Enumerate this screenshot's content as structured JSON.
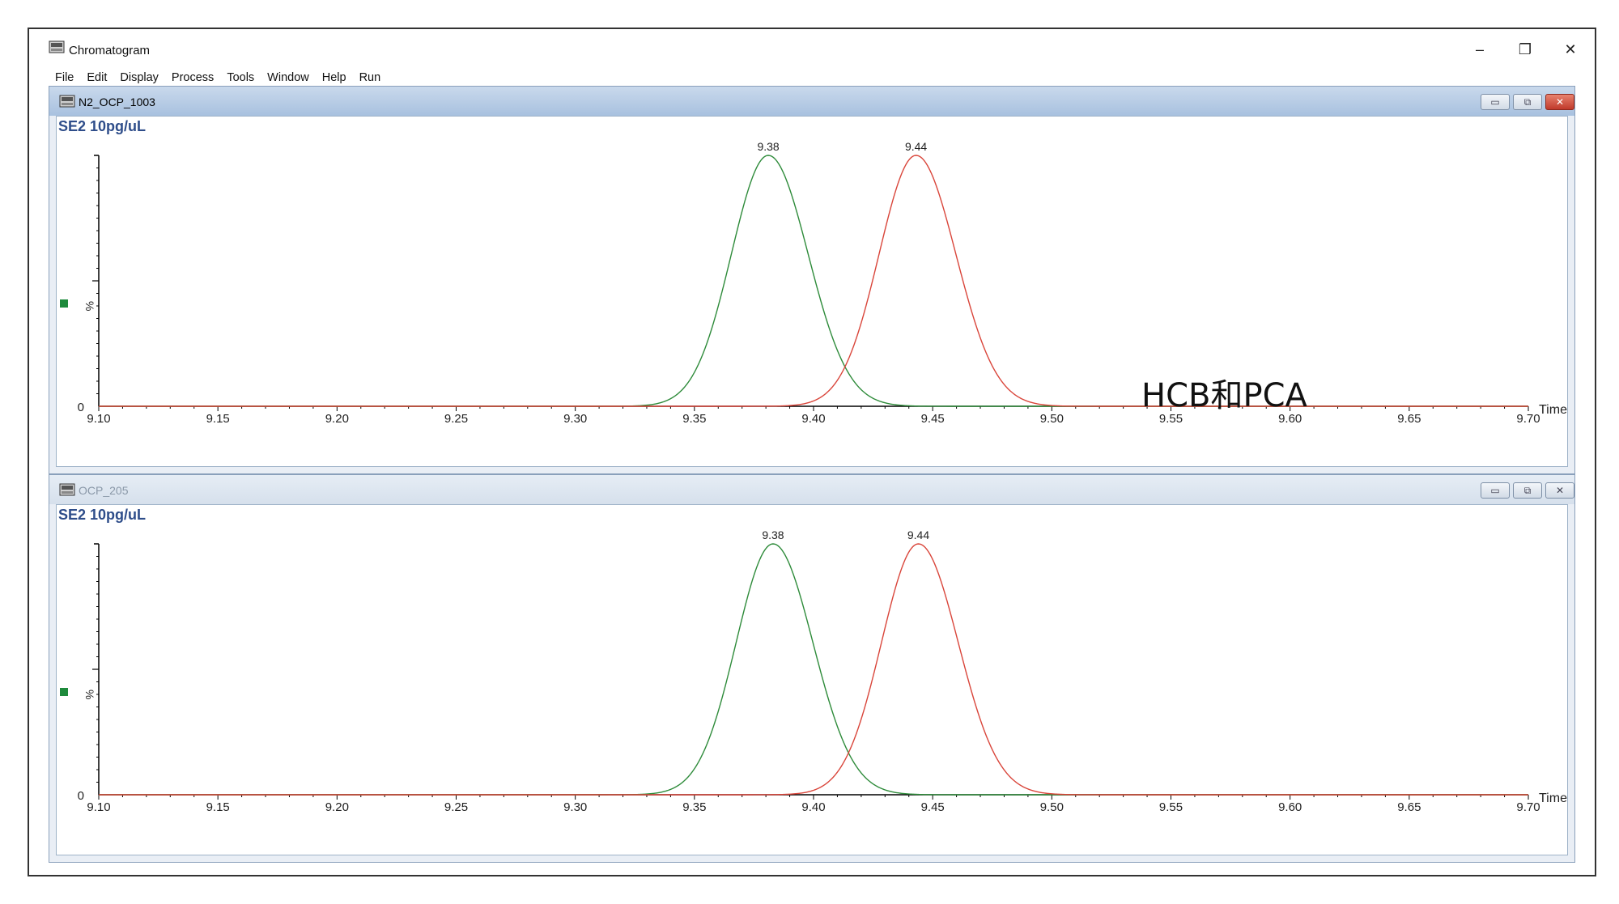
{
  "window": {
    "title": "Chromatogram",
    "controls": {
      "minimize": "–",
      "restore": "❐",
      "close": "✕"
    }
  },
  "menu": [
    "File",
    "Edit",
    "Display",
    "Process",
    "Tools",
    "Window",
    "Help",
    "Run"
  ],
  "annotation": "HCB和PCA",
  "panels": [
    {
      "title": "N2_OCP_1003",
      "state": "active",
      "sample": "SE2 10pg/uL",
      "y_label": "%",
      "y_zero": "0",
      "time_label": "Time",
      "x_ticks": [
        "9.10",
        "9.15",
        "9.20",
        "9.25",
        "9.30",
        "9.35",
        "9.40",
        "9.45",
        "9.50",
        "9.55",
        "9.60",
        "9.65",
        "9.70"
      ],
      "peak_labels": [
        "9.38",
        "9.44"
      ]
    },
    {
      "title": "OCP_205",
      "state": "inactive",
      "sample": "SE2 10pg/uL",
      "y_label": "%",
      "y_zero": "0",
      "time_label": "Time",
      "x_ticks": [
        "9.10",
        "9.15",
        "9.20",
        "9.25",
        "9.30",
        "9.35",
        "9.40",
        "9.45",
        "9.50",
        "9.55",
        "9.60",
        "9.65",
        "9.70"
      ],
      "peak_labels": [
        "9.38",
        "9.44"
      ]
    }
  ],
  "chart_data": [
    {
      "type": "line",
      "xlim": [
        9.1,
        9.7
      ],
      "ylim": [
        0,
        100
      ],
      "xlabel": "Time",
      "ylabel": "%",
      "series": [
        {
          "color": "#2e8b3a",
          "peak_x": 9.381,
          "peak_y": 100,
          "sigma": 0.0155,
          "peak_label": "9.38"
        },
        {
          "color": "#d9453a",
          "peak_x": 9.443,
          "peak_y": 100,
          "sigma": 0.0155,
          "peak_label": "9.44"
        }
      ]
    },
    {
      "type": "line",
      "xlim": [
        9.1,
        9.7
      ],
      "ylim": [
        0,
        100
      ],
      "xlabel": "Time",
      "ylabel": "%",
      "series": [
        {
          "color": "#2e8b3a",
          "peak_x": 9.383,
          "peak_y": 100,
          "sigma": 0.0155,
          "peak_label": "9.38"
        },
        {
          "color": "#d9453a",
          "peak_x": 9.444,
          "peak_y": 100,
          "sigma": 0.0155,
          "peak_label": "9.44"
        }
      ]
    }
  ]
}
